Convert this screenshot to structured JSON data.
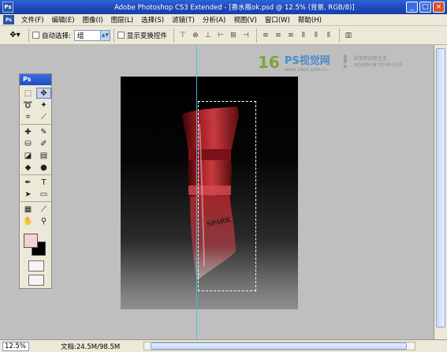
{
  "window": {
    "title": "Adobe Photoshop CS3 Extended - [香水瓶ok.psd @ 12.5% (背景, RGB/8)]",
    "app_icon": "Ps"
  },
  "menu": [
    "文件(F)",
    "编辑(E)",
    "图像(I)",
    "图层(L)",
    "选择(S)",
    "滤镜(T)",
    "分析(A)",
    "视图(V)",
    "窗口(W)",
    "帮助(H)"
  ],
  "options": {
    "auto_select_label": "自动选择:",
    "auto_select_value": "组",
    "show_transform_label": "显示变换控件"
  },
  "toolbox": {
    "header": "Ps"
  },
  "watermark": {
    "logo_number": "16",
    "site_name": "PS视觉网",
    "url": "www.16ps.com.cn",
    "slogan_line1": "视觉即创新生活",
    "slogan_line2": "VISION IN YOUR LIFE"
  },
  "bottle_text": "SPARK",
  "status": {
    "zoom": "12.5%",
    "doc_info": "文档:24.5M/98.5M"
  },
  "colors": {
    "foreground": "#f3d2d3",
    "background": "#000000",
    "guide": "#36c8e0",
    "bottle": "#9b1b23"
  }
}
